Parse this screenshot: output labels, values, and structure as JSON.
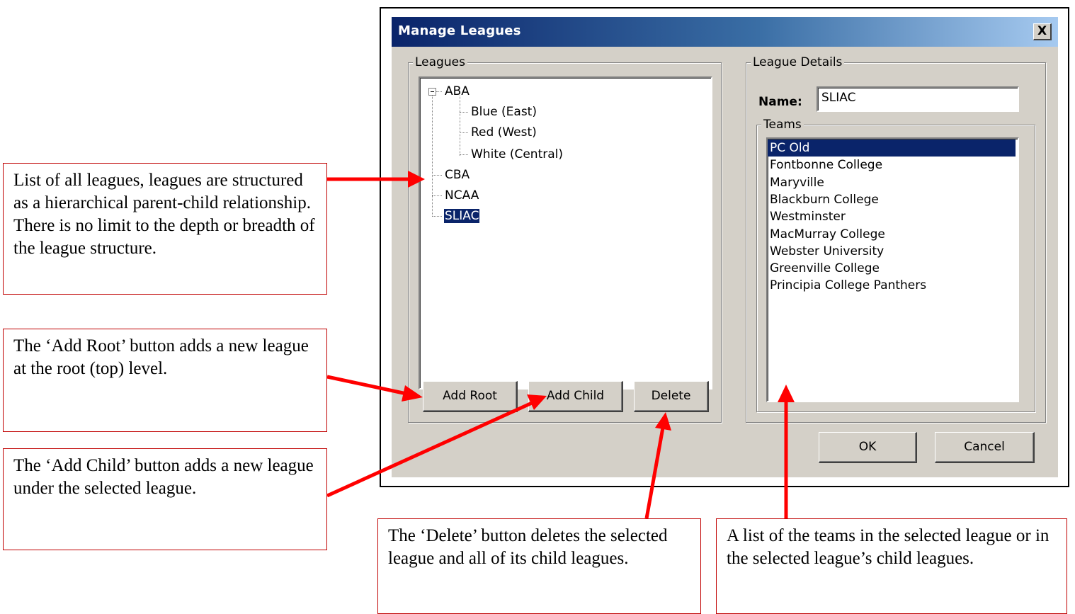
{
  "dialog": {
    "title": "Manage Leagues",
    "close_label": "X",
    "leagues_group_label": "Leagues",
    "details_group_label": "League Details",
    "teams_group_label": "Teams",
    "name_label": "Name:",
    "name_value": "SLIAC",
    "tree": {
      "abba": "ABA",
      "blue": "Blue (East)",
      "red": "Red (West)",
      "white": "White (Central)",
      "cba": "CBA",
      "ncaa": "NCAA",
      "sliac": "SLIAC"
    },
    "selected_league": "SLIAC",
    "teams": [
      "PC Old",
      "Fontbonne College",
      "Maryville",
      "Blackburn College",
      "Westminster",
      "MacMurray College",
      "Webster University",
      "Greenville College",
      "Principia College Panthers"
    ],
    "selected_team": "PC Old",
    "buttons": {
      "add_root": "Add Root",
      "add_child": "Add Child",
      "delete": "Delete",
      "ok": "OK",
      "cancel": "Cancel"
    }
  },
  "callouts": {
    "list": "List of all leagues, leagues are structured as a hierarchical parent-child relationship.  There is no limit to the depth or breadth of the league structure.",
    "add_root": "The ‘Add Root’ button adds a new league at the root (top) level.",
    "add_child": "The ‘Add Child’ button adds a new league under the selected league.",
    "delete": "The ‘Delete’ button deletes the selected league and all of its child leagues.",
    "teams": "A list of the teams in the selected league or in the selected league’s child leagues."
  },
  "colors": {
    "callout_border": "#c00000",
    "arrow": "#ff0000",
    "title_bar": "#0a246a",
    "dialog_face": "#d4d0c8",
    "selection": "#0a246a"
  },
  "icons": {
    "tree_expander": "minus-box-icon",
    "close": "close-icon"
  }
}
